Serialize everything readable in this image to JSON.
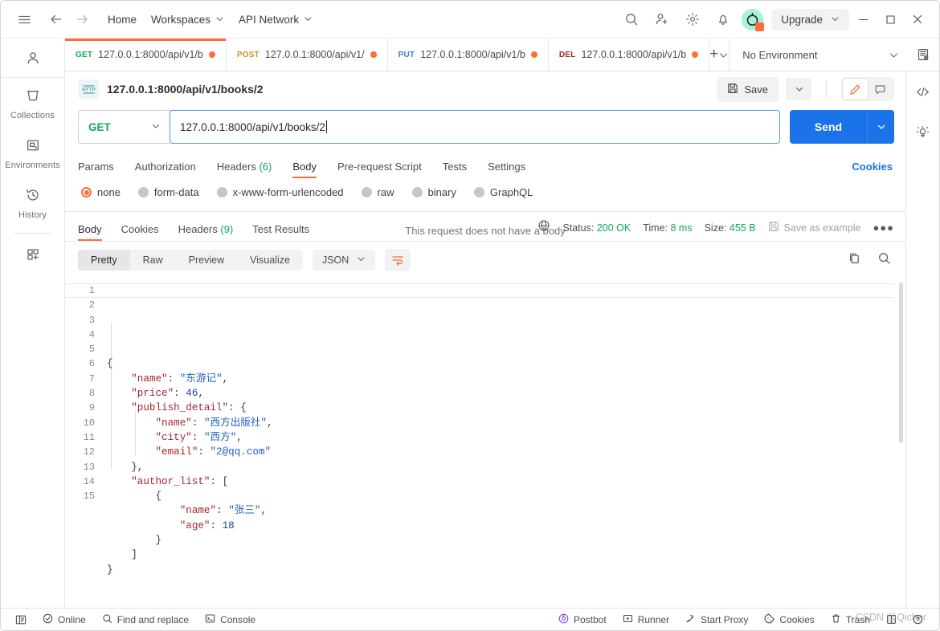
{
  "topbar": {
    "menu_icon": "hamburger-icon",
    "back_icon": "arrow-left-icon",
    "forward_icon": "arrow-right-icon",
    "home_label": "Home",
    "workspaces_label": "Workspaces",
    "api_network_label": "API Network",
    "search_icon": "search-icon",
    "invite_icon": "invite-user-icon",
    "settings_icon": "gear-icon",
    "notifications_icon": "bell-icon",
    "avatar_label": "",
    "upgrade_label": "Upgrade",
    "minimize_label": "—",
    "maximize_label": "□",
    "close_label": "✕"
  },
  "rail": {
    "profile_icon": "user-icon",
    "items": [
      {
        "label": "Collections",
        "icon": "collections-icon"
      },
      {
        "label": "Environments",
        "icon": "environments-icon"
      },
      {
        "label": "History",
        "icon": "history-icon"
      }
    ],
    "add_label": "new-apps-icon"
  },
  "tabs": {
    "items": [
      {
        "method": "GET",
        "url": "127.0.0.1:8000/api/v1/b",
        "active": true,
        "unsaved": true
      },
      {
        "method": "POST",
        "url": "127.0.0.1:8000/api/v1/",
        "active": false,
        "unsaved": true
      },
      {
        "method": "PUT",
        "url": "127.0.0.1:8000/api/v1/b",
        "active": false,
        "unsaved": true
      },
      {
        "method": "DEL",
        "url": "127.0.0.1:8000/api/v1/b",
        "active": false,
        "unsaved": true
      }
    ],
    "new_tab_label": "+",
    "environment_name": "No Environment"
  },
  "request": {
    "name": "127.0.0.1:8000/api/v1/books/2",
    "type_badge": "HTTP",
    "save_label": "Save",
    "method": "GET",
    "url": "127.0.0.1:8000/api/v1/books/2",
    "send_label": "Send",
    "tabs": [
      {
        "label": "Params",
        "count": "",
        "active": false
      },
      {
        "label": "Authorization",
        "count": "",
        "active": false
      },
      {
        "label": "Headers",
        "count": "(6)",
        "active": false
      },
      {
        "label": "Body",
        "count": "",
        "active": true
      },
      {
        "label": "Pre-request Script",
        "count": "",
        "active": false
      },
      {
        "label": "Tests",
        "count": "",
        "active": false
      },
      {
        "label": "Settings",
        "count": "",
        "active": false
      }
    ],
    "cookies_link": "Cookies",
    "body_types": [
      {
        "label": "none",
        "selected": true
      },
      {
        "label": "form-data",
        "selected": false
      },
      {
        "label": "x-www-form-urlencoded",
        "selected": false
      },
      {
        "label": "raw",
        "selected": false
      },
      {
        "label": "binary",
        "selected": false
      },
      {
        "label": "GraphQL",
        "selected": false
      }
    ],
    "empty_body_text": "This request does not have a body"
  },
  "response": {
    "tabs": [
      {
        "label": "Body",
        "count": "",
        "active": true
      },
      {
        "label": "Cookies",
        "count": "",
        "active": false
      },
      {
        "label": "Headers",
        "count": "(9)",
        "active": false
      },
      {
        "label": "Test Results",
        "count": "",
        "active": false
      }
    ],
    "status_label": "Status:",
    "status_value": "200 OK",
    "time_label": "Time:",
    "time_value": "8 ms",
    "size_label": "Size:",
    "size_value": "455 B",
    "save_example_label": "Save as example",
    "more_label": "●●●",
    "format_tabs": [
      {
        "label": "Pretty",
        "selected": true
      },
      {
        "label": "Raw",
        "selected": false
      },
      {
        "label": "Preview",
        "selected": false
      },
      {
        "label": "Visualize",
        "selected": false
      }
    ],
    "content_type": "JSON",
    "wrap_icon": "wrap-lines-icon",
    "copy_icon": "copy-icon",
    "search_icon": "search-icon",
    "body_lines": [
      {
        "n": "1",
        "html": "<span class='p'>{</span>"
      },
      {
        "n": "2",
        "html": "    <span class='k'>\"name\"</span><span class='p'>: </span><span class='s'>\"东游记\"</span><span class='p'>,</span>"
      },
      {
        "n": "3",
        "html": "    <span class='k'>\"price\"</span><span class='p'>: </span><span class='n'>46</span><span class='p'>,</span>"
      },
      {
        "n": "4",
        "html": "    <span class='k'>\"publish_detail\"</span><span class='p'>: {</span>"
      },
      {
        "n": "5",
        "html": "        <span class='k'>\"name\"</span><span class='p'>: </span><span class='s'>\"西方出版社\"</span><span class='p'>,</span>"
      },
      {
        "n": "6",
        "html": "        <span class='k'>\"city\"</span><span class='p'>: </span><span class='s'>\"西方\"</span><span class='p'>,</span>"
      },
      {
        "n": "7",
        "html": "        <span class='k'>\"email\"</span><span class='p'>: </span><span class='s'>\"2@qq.com\"</span>"
      },
      {
        "n": "8",
        "html": "    <span class='p'>},</span>"
      },
      {
        "n": "9",
        "html": "    <span class='k'>\"author_list\"</span><span class='p'>: [</span>"
      },
      {
        "n": "10",
        "html": "        <span class='p'>{</span>"
      },
      {
        "n": "11",
        "html": "            <span class='k'>\"name\"</span><span class='p'>: </span><span class='s'>\"张三\"</span><span class='p'>,</span>"
      },
      {
        "n": "12",
        "html": "            <span class='k'>\"age\"</span><span class='p'>: </span><span class='n'>18</span>"
      },
      {
        "n": "13",
        "html": "        <span class='p'>}</span>"
      },
      {
        "n": "14",
        "html": "    <span class='p'>]</span>"
      },
      {
        "n": "15",
        "html": "<span class='p'>}</span>"
      }
    ]
  },
  "right_rail": {
    "code_icon": "code-snippet-icon",
    "info_icon": "lightbulb-icon",
    "env_quicklook_icon": "environment-quicklook-icon"
  },
  "statusbar": {
    "left": [
      {
        "label": "",
        "icon": "sidebar-toggle-icon"
      },
      {
        "label": "Online",
        "icon": "online-check-icon"
      },
      {
        "label": "Find and replace",
        "icon": "search-icon"
      },
      {
        "label": "Console",
        "icon": "console-icon"
      }
    ],
    "right": [
      {
        "label": "Postbot",
        "icon": "postbot-icon"
      },
      {
        "label": "Runner",
        "icon": "runner-icon"
      },
      {
        "label": "Start Proxy",
        "icon": "proxy-icon"
      },
      {
        "label": "Cookies",
        "icon": "cookie-icon"
      },
      {
        "label": "Trash",
        "icon": "trash-icon"
      },
      {
        "label": "",
        "icon": "layout-icon"
      },
      {
        "label": "",
        "icon": "help-icon"
      }
    ],
    "watermark": "CSDN @Qicher"
  },
  "colors": {
    "accent": "#ff6c37",
    "send": "#1a73e8",
    "get": "#0fa958",
    "post": "#c7922b",
    "put": "#3a7bd5",
    "delete": "#a4252c"
  }
}
